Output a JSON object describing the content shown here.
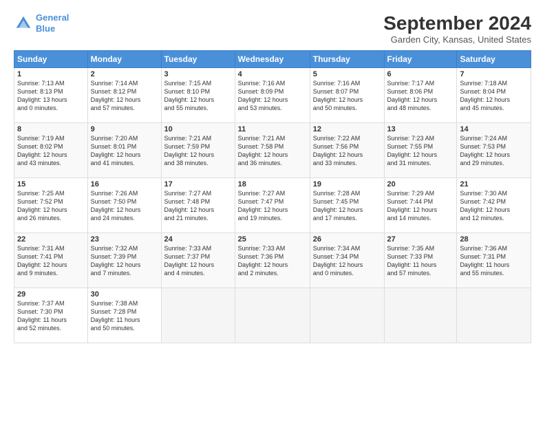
{
  "logo": {
    "line1": "General",
    "line2": "Blue"
  },
  "title": "September 2024",
  "location": "Garden City, Kansas, United States",
  "days_header": [
    "Sunday",
    "Monday",
    "Tuesday",
    "Wednesday",
    "Thursday",
    "Friday",
    "Saturday"
  ],
  "weeks": [
    [
      {
        "num": "1",
        "info": "Sunrise: 7:13 AM\nSunset: 8:13 PM\nDaylight: 13 hours\nand 0 minutes."
      },
      {
        "num": "2",
        "info": "Sunrise: 7:14 AM\nSunset: 8:12 PM\nDaylight: 12 hours\nand 57 minutes."
      },
      {
        "num": "3",
        "info": "Sunrise: 7:15 AM\nSunset: 8:10 PM\nDaylight: 12 hours\nand 55 minutes."
      },
      {
        "num": "4",
        "info": "Sunrise: 7:16 AM\nSunset: 8:09 PM\nDaylight: 12 hours\nand 53 minutes."
      },
      {
        "num": "5",
        "info": "Sunrise: 7:16 AM\nSunset: 8:07 PM\nDaylight: 12 hours\nand 50 minutes."
      },
      {
        "num": "6",
        "info": "Sunrise: 7:17 AM\nSunset: 8:06 PM\nDaylight: 12 hours\nand 48 minutes."
      },
      {
        "num": "7",
        "info": "Sunrise: 7:18 AM\nSunset: 8:04 PM\nDaylight: 12 hours\nand 45 minutes."
      }
    ],
    [
      {
        "num": "8",
        "info": "Sunrise: 7:19 AM\nSunset: 8:02 PM\nDaylight: 12 hours\nand 43 minutes."
      },
      {
        "num": "9",
        "info": "Sunrise: 7:20 AM\nSunset: 8:01 PM\nDaylight: 12 hours\nand 41 minutes."
      },
      {
        "num": "10",
        "info": "Sunrise: 7:21 AM\nSunset: 7:59 PM\nDaylight: 12 hours\nand 38 minutes."
      },
      {
        "num": "11",
        "info": "Sunrise: 7:21 AM\nSunset: 7:58 PM\nDaylight: 12 hours\nand 36 minutes."
      },
      {
        "num": "12",
        "info": "Sunrise: 7:22 AM\nSunset: 7:56 PM\nDaylight: 12 hours\nand 33 minutes."
      },
      {
        "num": "13",
        "info": "Sunrise: 7:23 AM\nSunset: 7:55 PM\nDaylight: 12 hours\nand 31 minutes."
      },
      {
        "num": "14",
        "info": "Sunrise: 7:24 AM\nSunset: 7:53 PM\nDaylight: 12 hours\nand 29 minutes."
      }
    ],
    [
      {
        "num": "15",
        "info": "Sunrise: 7:25 AM\nSunset: 7:52 PM\nDaylight: 12 hours\nand 26 minutes."
      },
      {
        "num": "16",
        "info": "Sunrise: 7:26 AM\nSunset: 7:50 PM\nDaylight: 12 hours\nand 24 minutes."
      },
      {
        "num": "17",
        "info": "Sunrise: 7:27 AM\nSunset: 7:48 PM\nDaylight: 12 hours\nand 21 minutes."
      },
      {
        "num": "18",
        "info": "Sunrise: 7:27 AM\nSunset: 7:47 PM\nDaylight: 12 hours\nand 19 minutes."
      },
      {
        "num": "19",
        "info": "Sunrise: 7:28 AM\nSunset: 7:45 PM\nDaylight: 12 hours\nand 17 minutes."
      },
      {
        "num": "20",
        "info": "Sunrise: 7:29 AM\nSunset: 7:44 PM\nDaylight: 12 hours\nand 14 minutes."
      },
      {
        "num": "21",
        "info": "Sunrise: 7:30 AM\nSunset: 7:42 PM\nDaylight: 12 hours\nand 12 minutes."
      }
    ],
    [
      {
        "num": "22",
        "info": "Sunrise: 7:31 AM\nSunset: 7:41 PM\nDaylight: 12 hours\nand 9 minutes."
      },
      {
        "num": "23",
        "info": "Sunrise: 7:32 AM\nSunset: 7:39 PM\nDaylight: 12 hours\nand 7 minutes."
      },
      {
        "num": "24",
        "info": "Sunrise: 7:33 AM\nSunset: 7:37 PM\nDaylight: 12 hours\nand 4 minutes."
      },
      {
        "num": "25",
        "info": "Sunrise: 7:33 AM\nSunset: 7:36 PM\nDaylight: 12 hours\nand 2 minutes."
      },
      {
        "num": "26",
        "info": "Sunrise: 7:34 AM\nSunset: 7:34 PM\nDaylight: 12 hours\nand 0 minutes."
      },
      {
        "num": "27",
        "info": "Sunrise: 7:35 AM\nSunset: 7:33 PM\nDaylight: 11 hours\nand 57 minutes."
      },
      {
        "num": "28",
        "info": "Sunrise: 7:36 AM\nSunset: 7:31 PM\nDaylight: 11 hours\nand 55 minutes."
      }
    ],
    [
      {
        "num": "29",
        "info": "Sunrise: 7:37 AM\nSunset: 7:30 PM\nDaylight: 11 hours\nand 52 minutes."
      },
      {
        "num": "30",
        "info": "Sunrise: 7:38 AM\nSunset: 7:28 PM\nDaylight: 11 hours\nand 50 minutes."
      },
      {
        "num": "",
        "info": ""
      },
      {
        "num": "",
        "info": ""
      },
      {
        "num": "",
        "info": ""
      },
      {
        "num": "",
        "info": ""
      },
      {
        "num": "",
        "info": ""
      }
    ]
  ]
}
